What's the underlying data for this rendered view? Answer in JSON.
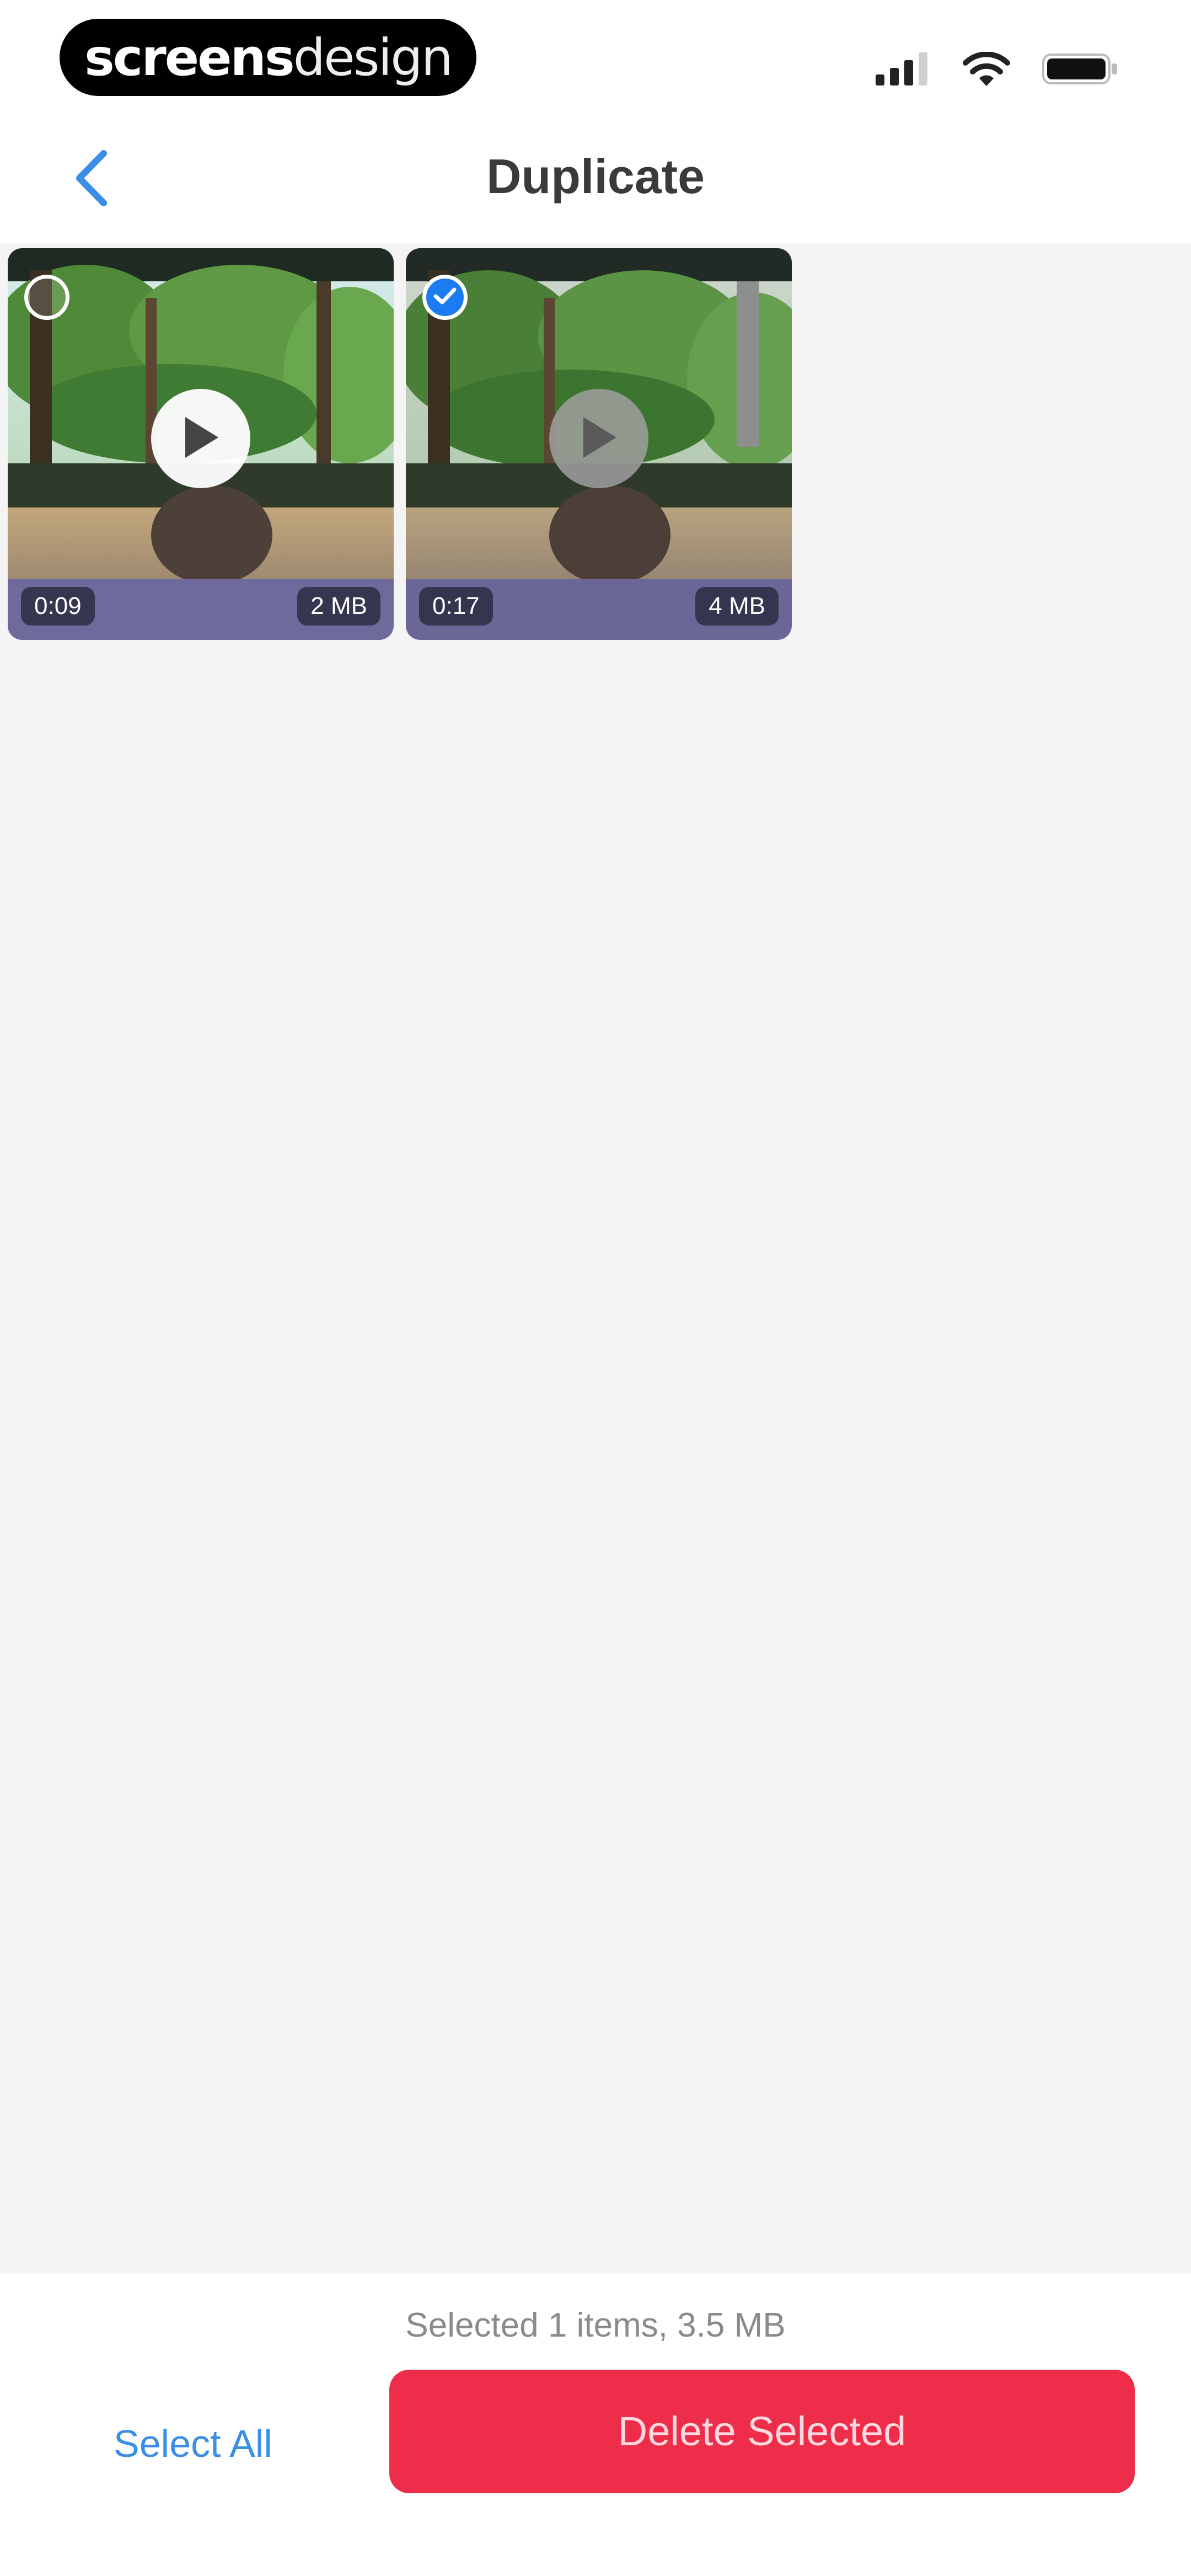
{
  "status_bar": {
    "brand_part1": "screens",
    "brand_part2": "design",
    "icons": [
      "cellular-signal-icon",
      "wifi-icon",
      "battery-icon"
    ]
  },
  "nav": {
    "back_icon": "chevron-left-icon",
    "title": "Duplicate",
    "accent_color": "#3a8ee6"
  },
  "items": [
    {
      "duration": "0:09",
      "size": "2 MB",
      "selected": false,
      "play_icon": "play-icon"
    },
    {
      "duration": "0:17",
      "size": "4 MB",
      "selected": true,
      "play_icon": "play-icon"
    }
  ],
  "footer": {
    "summary": "Selected 1 items, 3.5 MB",
    "select_all_label": "Select All",
    "delete_label": "Delete Selected",
    "delete_color": "#ee2d4a",
    "select_color": "#1b7cf2"
  }
}
